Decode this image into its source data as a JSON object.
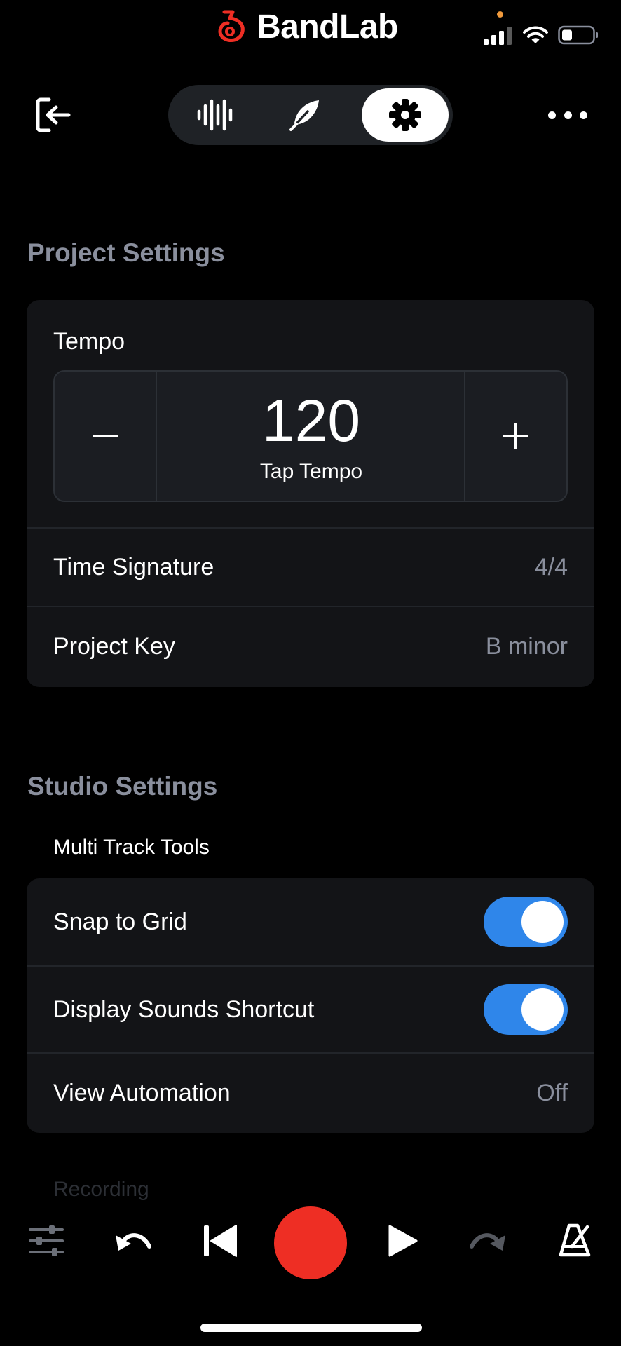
{
  "app": {
    "brand": "BandLab"
  },
  "colors": {
    "accent": "#2f86ea",
    "record": "#ee2e24",
    "brand": "#ee2e24",
    "muted": "#8a8f9d"
  },
  "toolbar": {
    "icons": [
      "exit-icon",
      "waveform-icon",
      "feather-icon",
      "gear-icon",
      "more-icon"
    ],
    "active_tab": "gear-icon"
  },
  "project_settings": {
    "title": "Project Settings",
    "tempo": {
      "label": "Tempo",
      "value": "120",
      "minus": "−",
      "plus": "+",
      "tap": "Tap Tempo"
    },
    "rows": [
      {
        "label": "Time Signature",
        "value": "4/4"
      },
      {
        "label": "Project Key",
        "value": "B minor"
      }
    ]
  },
  "studio_settings": {
    "title": "Studio Settings",
    "subtitle": "Multi Track Tools",
    "toggles": [
      {
        "label": "Snap to Grid",
        "on": true
      },
      {
        "label": "Display Sounds Shortcut",
        "on": true
      }
    ],
    "view_automation": {
      "label": "View Automation",
      "value": "Off"
    },
    "next_section": "Recording"
  },
  "transport": {
    "icons": [
      "mixer-icon",
      "undo-icon",
      "skip-back-icon",
      "record-icon",
      "play-icon",
      "redo-icon",
      "metronome-icon"
    ]
  }
}
